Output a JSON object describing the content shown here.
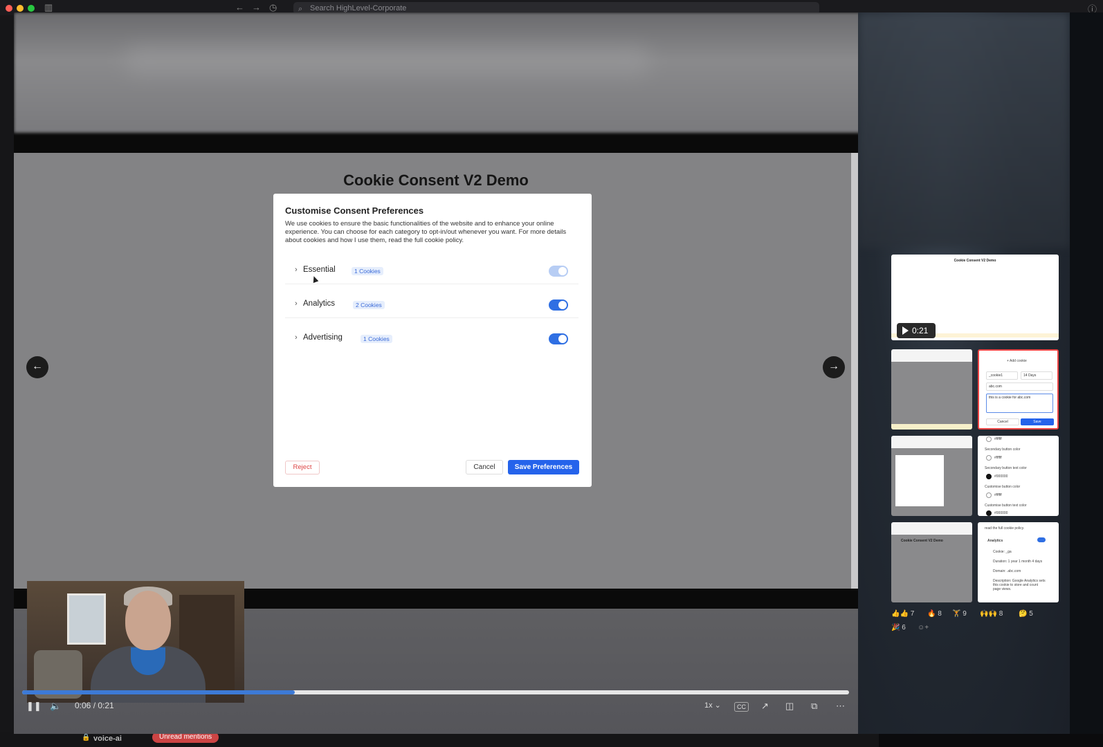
{
  "browser": {
    "search_placeholder": "Search HighLevel-Corporate"
  },
  "behind": {
    "channel": "voice-ai",
    "unread": "Unread mentions"
  },
  "slide": {
    "title": "Cookie Consent V2 Demo",
    "dialog": {
      "title": "Customise Consent Preferences",
      "description": "We use cookies to ensure the basic functionalities of the website and to enhance your online experience. You can choose for each category to opt-in/out whenever you want. For more details about cookies and how I use them, read the full cookie policy.",
      "categories": [
        {
          "name": "Essential",
          "count": "1 Cookies",
          "enabled": true,
          "locked": true
        },
        {
          "name": "Analytics",
          "count": "2 Cookies",
          "enabled": true,
          "locked": false
        },
        {
          "name": "Advertising",
          "count": "1 Cookies",
          "enabled": true,
          "locked": false
        }
      ],
      "reject_label": "Reject",
      "cancel_label": "Cancel",
      "save_label": "Save Preferences"
    }
  },
  "player": {
    "time": "0:06 / 0:21",
    "progress_fraction": 0.33,
    "speed": "1x",
    "cc_label": "CC"
  },
  "gallery": {
    "main_duration": "0:21",
    "main_title": "Cookie Consent V2 Demo",
    "thumb_add_cookie": {
      "header": "+ Add cookie",
      "name": "_cookie1",
      "duration": "14 Days",
      "domain": "abc.com",
      "description": "this is a cookie for abc.com",
      "cancel": "Cancel",
      "save": "Save"
    },
    "thumb_colors": {
      "rows": [
        "#ffffff",
        "Secondary button color",
        "#ffffff",
        "Secondary button text color",
        "#000000",
        "Customise button color",
        "#ffffff",
        "Customise button text color",
        "#000000"
      ]
    },
    "thumb_title_small": "Cookie Consent V2 Demo",
    "thumb_analytics": {
      "intro": "read the full cookie policy.",
      "label": "Analytics",
      "rows": [
        "Cookie: _ga",
        "Duration: 1 year 1 month 4 days",
        "Domain: .abc.com",
        "Description: Google Analytics sets this cookie to store and count page views."
      ]
    }
  },
  "reactions": [
    {
      "emoji": "👍👍",
      "count": "7"
    },
    {
      "emoji": "🔥",
      "count": "8"
    },
    {
      "emoji": "🏋",
      "count": "9"
    },
    {
      "emoji": "🙌🙌",
      "count": "8"
    },
    {
      "emoji": "🤔",
      "count": "5"
    },
    {
      "emoji": "🎉",
      "count": "6"
    }
  ]
}
